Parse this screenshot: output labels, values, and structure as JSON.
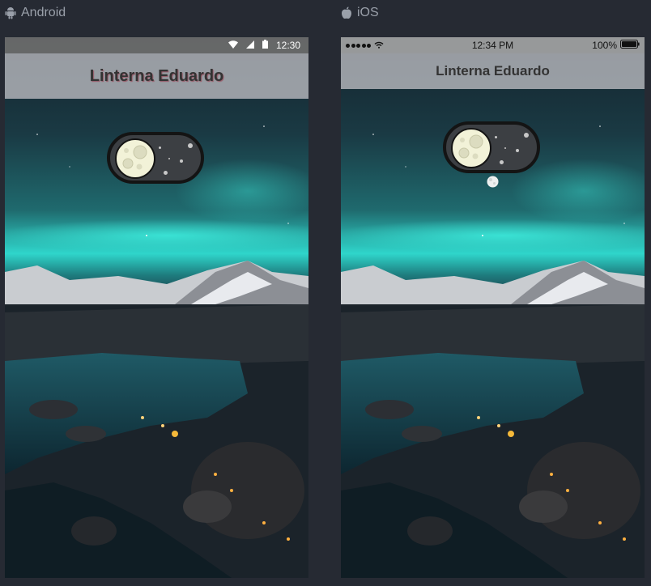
{
  "platforms": {
    "android": {
      "label": "Android",
      "icon": "android-icon",
      "status_time": "12:30",
      "status_icons": [
        "wifi-icon",
        "signal-icon",
        "battery-icon"
      ],
      "app_title": "Linterna Eduardo",
      "toggle_state": "off"
    },
    "ios": {
      "label": "iOS",
      "icon": "apple-icon",
      "status_time": "12:34 PM",
      "status_battery": "100%",
      "status_icons": [
        "signal-dots-icon",
        "wifi-icon",
        "battery-icon"
      ],
      "app_title": "Linterna Eduardo",
      "toggle_state": "off"
    }
  },
  "colors": {
    "page_background": "#262a33",
    "aurora": "#2de0d0",
    "toggle_track": "#3c3f43",
    "moon": "#f0f0d8"
  }
}
